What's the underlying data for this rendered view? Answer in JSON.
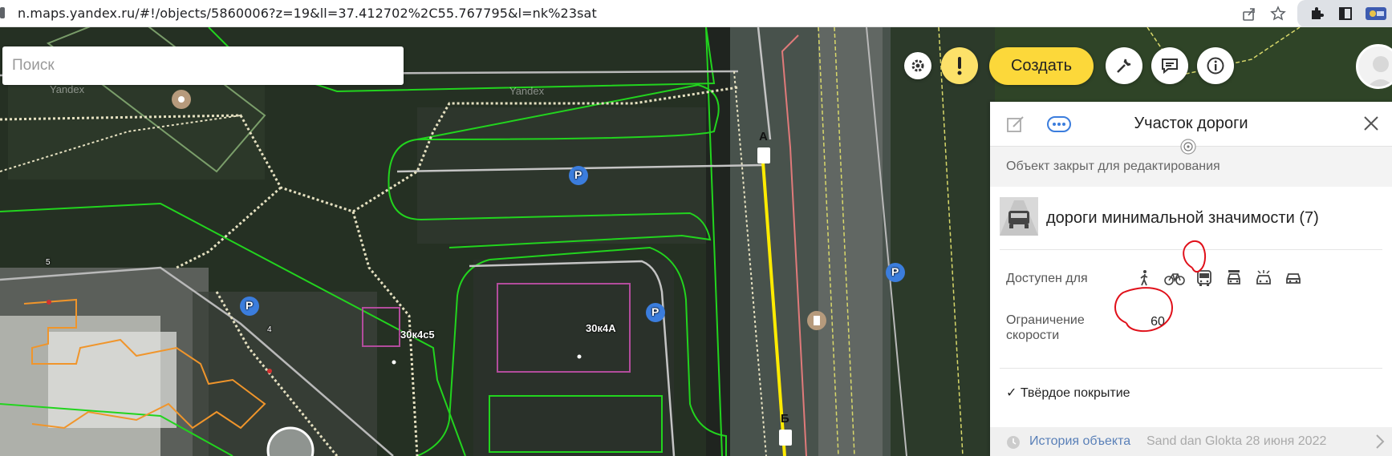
{
  "browser": {
    "url": "n.maps.yandex.ru/#!/objects/5860006?z=19&ll=37.412702%2C55.767795&l=nk%23sat",
    "icons": [
      "share-icon",
      "star-icon",
      "extensions-icon",
      "sidebar-icon",
      "profile-extension-icon"
    ]
  },
  "search": {
    "placeholder": "Поиск"
  },
  "toolbar": {
    "create_label": "Создать",
    "icons": [
      "settings-icon",
      "alert-icon",
      "wrench-icon",
      "comment-icon",
      "info-icon"
    ]
  },
  "map": {
    "watermarks": [
      "Yandex",
      "Yandex"
    ],
    "building_labels": [
      "30к4с5",
      "30к4А"
    ],
    "house_numbers": [
      "5",
      "4"
    ],
    "road_point_labels": [
      "А",
      "Б"
    ],
    "parking_label": "P",
    "colors": {
      "road_highlight": "#ffeb00",
      "zone_outline": "#22d41e",
      "building_outline": "#f0952b",
      "zone_purple": "#b24c9c"
    }
  },
  "panel": {
    "title": "Участок дороги",
    "closed_note": "Объект закрыт для редактирования",
    "category": "дороги минимальной значимости (7)",
    "access_label": "Доступен для",
    "access_icons": [
      "pedestrian-icon",
      "bicycle-icon",
      "bus-icon",
      "taxi-icon",
      "truck-icon",
      "car-icon"
    ],
    "speed_label": "Ограничение скорости",
    "speed_value": "60",
    "surface": "✓ Твёрдое покрытие",
    "history_link": "История объекта",
    "history_meta": "Sand dan Glokta 28 июня 2022",
    "annotation_color": "#e0101a"
  }
}
